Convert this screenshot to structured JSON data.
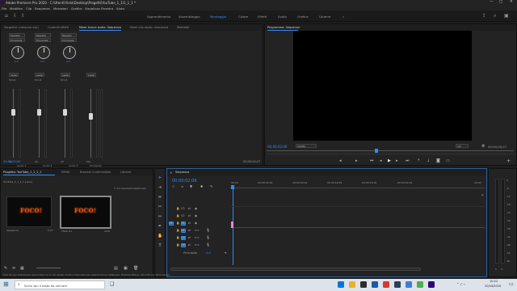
{
  "app": {
    "title": "Adobe Premiere Pro 2020 - C:\\Utenti\\Yiela\\Desktop\\Progetti\\YouTube_1_1\\1_1_1 *",
    "window_controls": [
      "—",
      "▢",
      "✕"
    ]
  },
  "menu": [
    "File",
    "Modifica",
    "Clip",
    "Sequenza",
    "Marcatori",
    "Grafica",
    "Visualizza",
    "Finestra",
    "Aiuto"
  ],
  "workspaces": {
    "items": [
      "Apprendimento",
      "Assemblaggio",
      "Montaggio",
      "Colore",
      "Effetti",
      "Audio",
      "Grafica",
      "Librerie",
      "»"
    ],
    "active": "Montaggio"
  },
  "source_panel": {
    "tabs": [
      "Sorgente: (nessuna clip)",
      "Controlli effetti",
      "Mixer tracce audio: Sequenza",
      "Mixer clip audio: Sequenza",
      "Metadati"
    ],
    "active_tab": "Mixer tracce audio: Sequenza",
    "mixer": {
      "channels": [
        {
          "dropdown": "Passaño",
          "route": "Principale",
          "pan": "0.0",
          "mode": "Leggi",
          "label": "A1",
          "name": "Audio 1"
        },
        {
          "dropdown": "Passaño",
          "route": "Principale",
          "pan": "0.0",
          "mode": "Leggi",
          "label": "A2",
          "name": "Audio 2"
        },
        {
          "dropdown": "Passaño",
          "route": "Principale",
          "pan": "0.0",
          "mode": "Leggi",
          "label": "A3",
          "name": "Audio 3"
        }
      ],
      "master": {
        "mode": "Leggi",
        "label": "Mix",
        "name": "Principale"
      },
      "fader_value": "0.0",
      "meter_scale": [
        "6",
        "0",
        "-6",
        "-12",
        "-18",
        "-24",
        "-30",
        "-36",
        "-42",
        "-48",
        "-54",
        "dB"
      ],
      "footer_time": "00;00;00;00",
      "footer_time_right": "00;00;04;27"
    }
  },
  "program": {
    "tab": "Programma: Sequenza",
    "timecode": "00;00;02;06",
    "fit": "Adatta",
    "fraction": "1/2",
    "duration": "00;00;04;27"
  },
  "project": {
    "tabs": [
      "Progetto: YouTube_1_1_1_1",
      "Effetti",
      "Browser multimediale",
      "Librerie"
    ],
    "active_tab": "Progetto: YouTube_1_1_1_1",
    "path": "YouTube_1_1_1_1.prproj",
    "selection": "1 di 2 elementi selezionati",
    "items": [
      {
        "name": "Sequenza",
        "duration": "5;27",
        "thumb_text": "FOCO!"
      },
      {
        "name": "Titolo 01",
        "duration": "4;29",
        "thumb_text": "FOCO!"
      }
    ]
  },
  "timeline": {
    "tab": "Sequenza",
    "timecode": "00;00;02;06",
    "ruler": [
      "00;00",
      "00;00;04;29",
      "00;00;09;29",
      "00;00;14;29",
      "00;00;19;29",
      "00;00;24;29",
      "00;00"
    ],
    "tracks": [
      "V3",
      "V2",
      "V1",
      "A1",
      "A2",
      "A3",
      "Principale"
    ],
    "master_value": "0.0"
  },
  "meters": {
    "labels": [
      "0",
      "-6",
      "-12",
      "-18",
      "-24",
      "-30",
      "-36",
      "-42",
      "-48",
      "-54",
      "dB"
    ],
    "solo": [
      "S",
      "S"
    ]
  },
  "status_bar": {
    "text": "Fare clic per selezionare oppure fare clic in uno spazio vuoto e trascinare per selezionare un rettangolo. Premere Maiusc, Alt e Ctrl per altre opzioni."
  },
  "taskbar": {
    "search_placeholder": "Scrivi qui il testo da cercare",
    "time": "10:22",
    "date": "20/04/2020"
  },
  "colors": {
    "accent": "#2d8cff",
    "panel": "#232323",
    "background": "#1d1d1d",
    "clip_pink": "#e58ad3"
  }
}
